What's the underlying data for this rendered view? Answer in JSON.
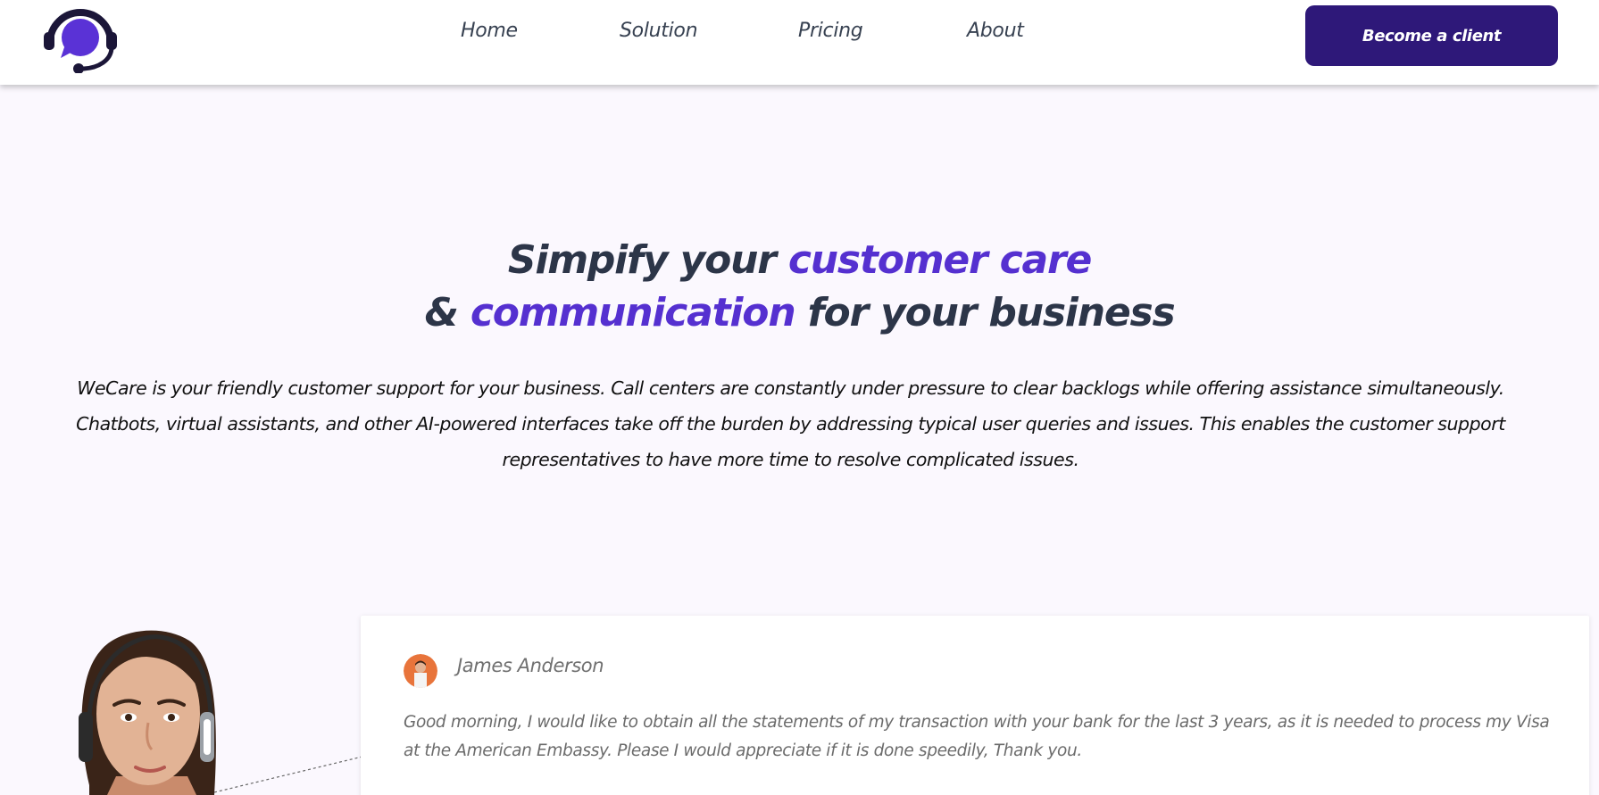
{
  "brand": {
    "logo_icon": "headset-chat-bubble-icon",
    "accent_color": "#5530d0",
    "cta_color": "#2e1879"
  },
  "nav": {
    "items": [
      {
        "label": "Home"
      },
      {
        "label": "Solution"
      },
      {
        "label": "Pricing"
      },
      {
        "label": "About"
      }
    ],
    "cta_label": "Become a client"
  },
  "hero": {
    "title_part1": "Simpify your ",
    "title_accent1": "customer care",
    "title_part2": "& ",
    "title_accent2": "communication",
    "title_part3": " for your business",
    "description": "WeCare is your friendly customer support for your business. Call centers are constantly under pressure to clear backlogs while offering assistance simultaneously. Chatbots, virtual assistants, and other AI-powered interfaces take off the burden by addressing typical user queries and issues. This enables the customer support representatives to have more time to resolve complicated issues."
  },
  "conversation": {
    "agent_image": "support-agent-with-headset-photo",
    "message": {
      "avatar": "user-avatar",
      "name": "James Anderson",
      "text": "Good morning, I would like to obtain all the statements of my transaction with your bank for the last 3 years, as it is needed to process my Visa at the American Embassy. Please I would appreciate if it is done speedily, Thank you."
    }
  }
}
